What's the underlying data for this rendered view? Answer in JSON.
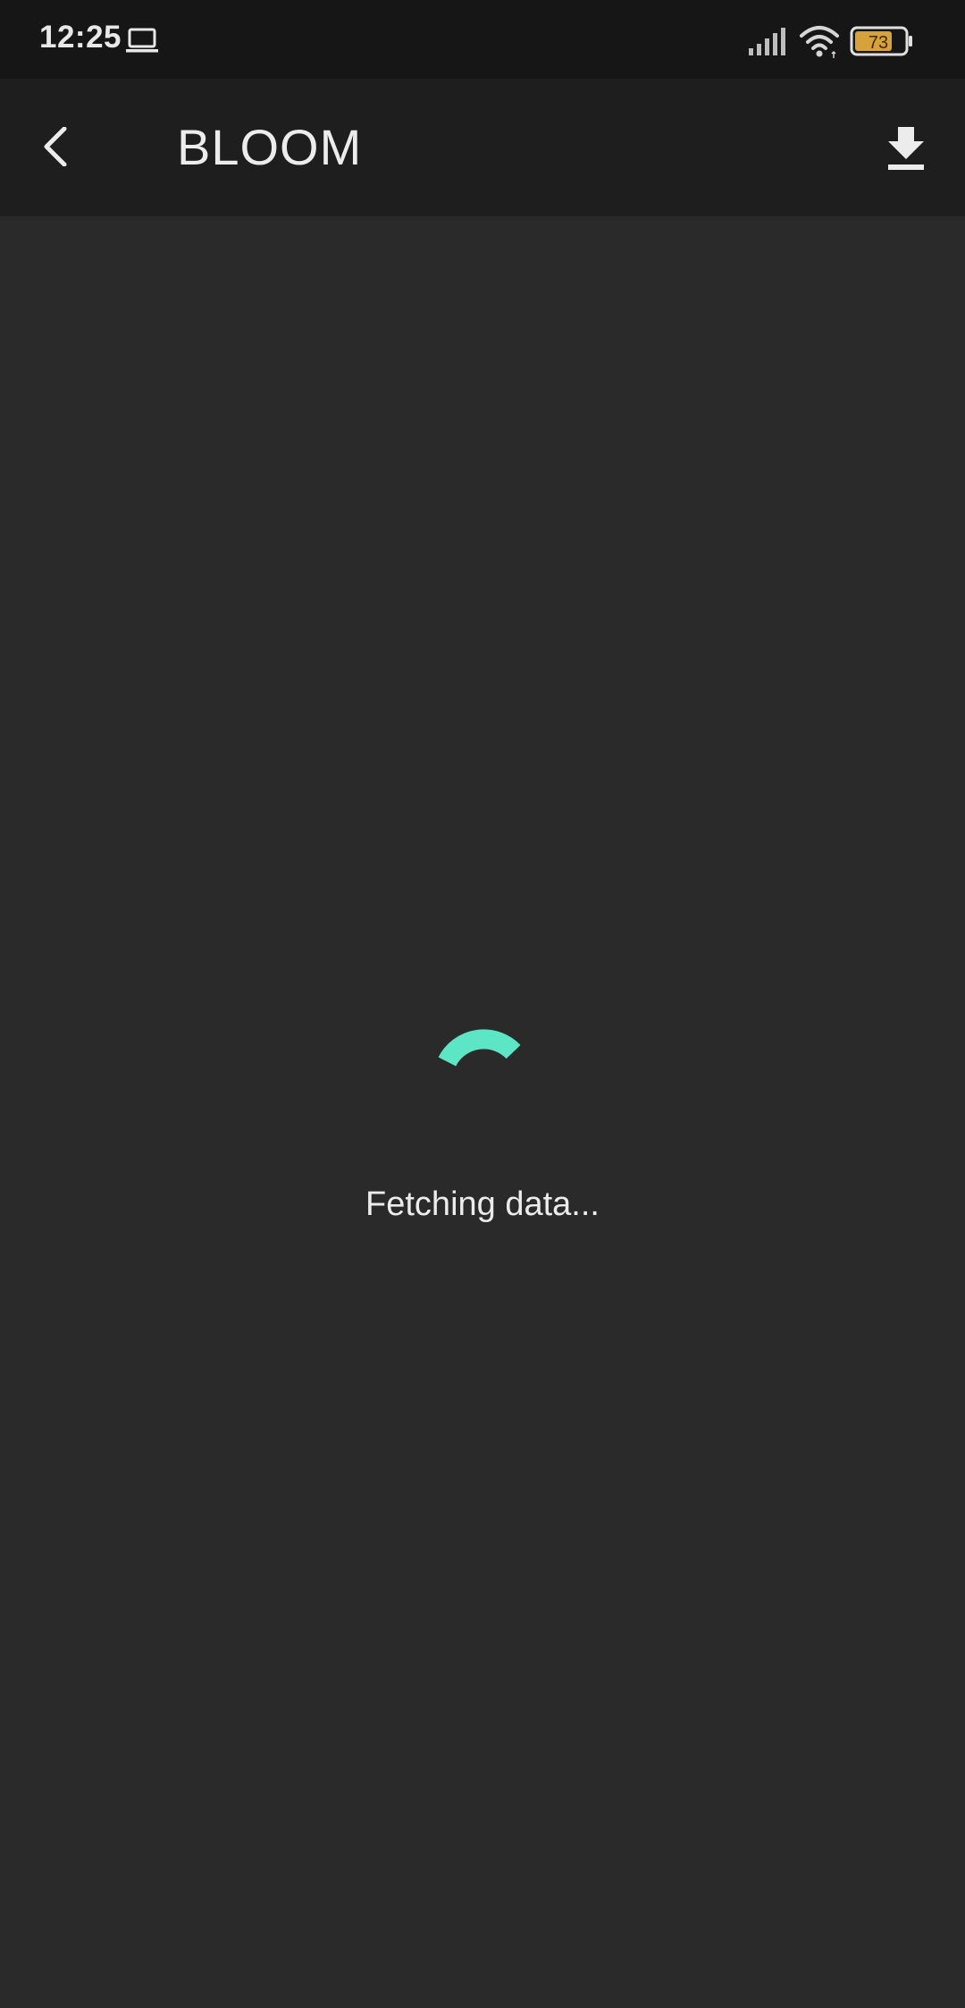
{
  "status_bar": {
    "time": "12:25",
    "battery_level": "73",
    "icons": [
      "laptop-icon",
      "signal-icon",
      "wifi-icon",
      "battery-icon"
    ]
  },
  "app_bar": {
    "title": "BLOOM",
    "icons": [
      "back-arrow-icon",
      "download-icon"
    ]
  },
  "main": {
    "loading_text": "Fetching data...",
    "spinner_color": "#5ce6c6",
    "icons": [
      "spinner-icon"
    ]
  },
  "colors": {
    "status_bar_bg": "#161616",
    "app_bar_bg": "#1e1e1e",
    "background": "#2a2a2a",
    "accent": "#5ce6c6",
    "battery_fill": "#d8a23a"
  }
}
